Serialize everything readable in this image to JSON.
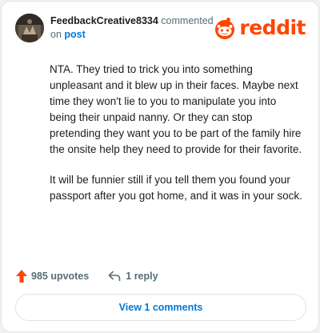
{
  "comment": {
    "username": "FeedbackCreative8334",
    "action_text": "commented",
    "on_text": "on",
    "post_link_text": "post",
    "paragraphs": [
      "NTA. They tried to trick you into something unpleasant and it blew up in their faces. Maybe next time they won't lie to you to manipulate you into being their unpaid nanny. Or they can stop pretending they want you to be part of the family hire the onsite help they need to provide for their favorite.",
      "It will be funnier still if you tell them you found your passport after you got home, and it was in your sock."
    ],
    "upvotes_label": "985 upvotes",
    "reply_label": "1 reply",
    "view_comments_label": "View 1 comments"
  },
  "brand": {
    "wordmark": "reddit",
    "color": "#ff4500"
  },
  "colors": {
    "link": "#0079d3",
    "upvote": "#ff4500",
    "muted": "#576f76"
  },
  "icons": {
    "avatar": "avatar",
    "logo": "reddit-snoo-icon",
    "upvote": "upvote-arrow-icon",
    "reply": "reply-arrow-icon"
  }
}
